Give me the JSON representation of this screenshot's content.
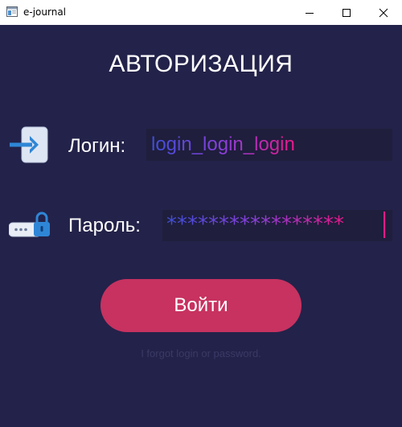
{
  "window": {
    "title": "e-journal",
    "icon": "app-window-icon"
  },
  "form": {
    "heading": "АВТОРИЗАЦИЯ",
    "login": {
      "label": "Логин:",
      "value": "login_login_login",
      "icon": "login-arrow-icon"
    },
    "password": {
      "label": "Пароль:",
      "value": "*****************",
      "icon": "password-lock-icon"
    },
    "submit_label": "Войти",
    "forgot_text": "I forgot login or password."
  },
  "colors": {
    "background": "#23224a",
    "input_background": "#1f1e3c",
    "button": "#c73260",
    "text_gradient_start": "#3d4fd8",
    "text_gradient_end": "#e8198a",
    "forgot_text": "#3a3a66"
  }
}
